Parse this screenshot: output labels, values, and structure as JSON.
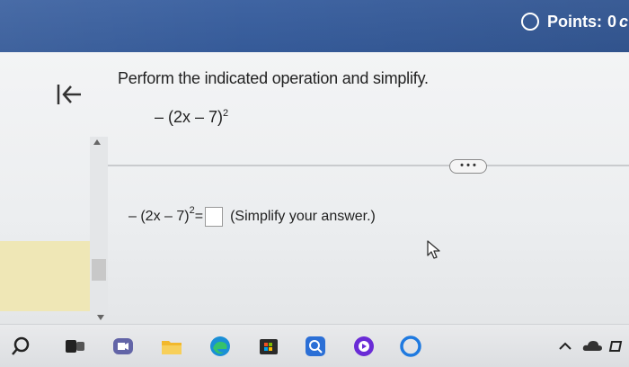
{
  "header": {
    "points_label": "Points:",
    "points_value": "0",
    "points_trailing": "c"
  },
  "question": {
    "instruction": "Perform the indicated operation and simplify.",
    "expression_prefix": "– (2x – 7)",
    "expression_exponent": "2",
    "answer_prefix": "– (2x – 7)",
    "answer_exponent": "2",
    "answer_equals": " =",
    "answer_value": "",
    "answer_hint": "(Simplify your answer.)"
  },
  "controls": {
    "more_label": "• • •"
  },
  "colors": {
    "header_bg": "#3d62a0",
    "instruction_text": "#222222",
    "left_panel": "#efe7b6"
  },
  "taskbar": {
    "icons": [
      "search-icon",
      "task-view-icon",
      "video-call-icon",
      "file-explorer-icon",
      "edge-browser-icon",
      "store-icon",
      "search-app-icon",
      "music-app-icon",
      "cortana-icon",
      "show-hidden-icons-icon",
      "cloud-icon",
      "battery-icon"
    ]
  }
}
